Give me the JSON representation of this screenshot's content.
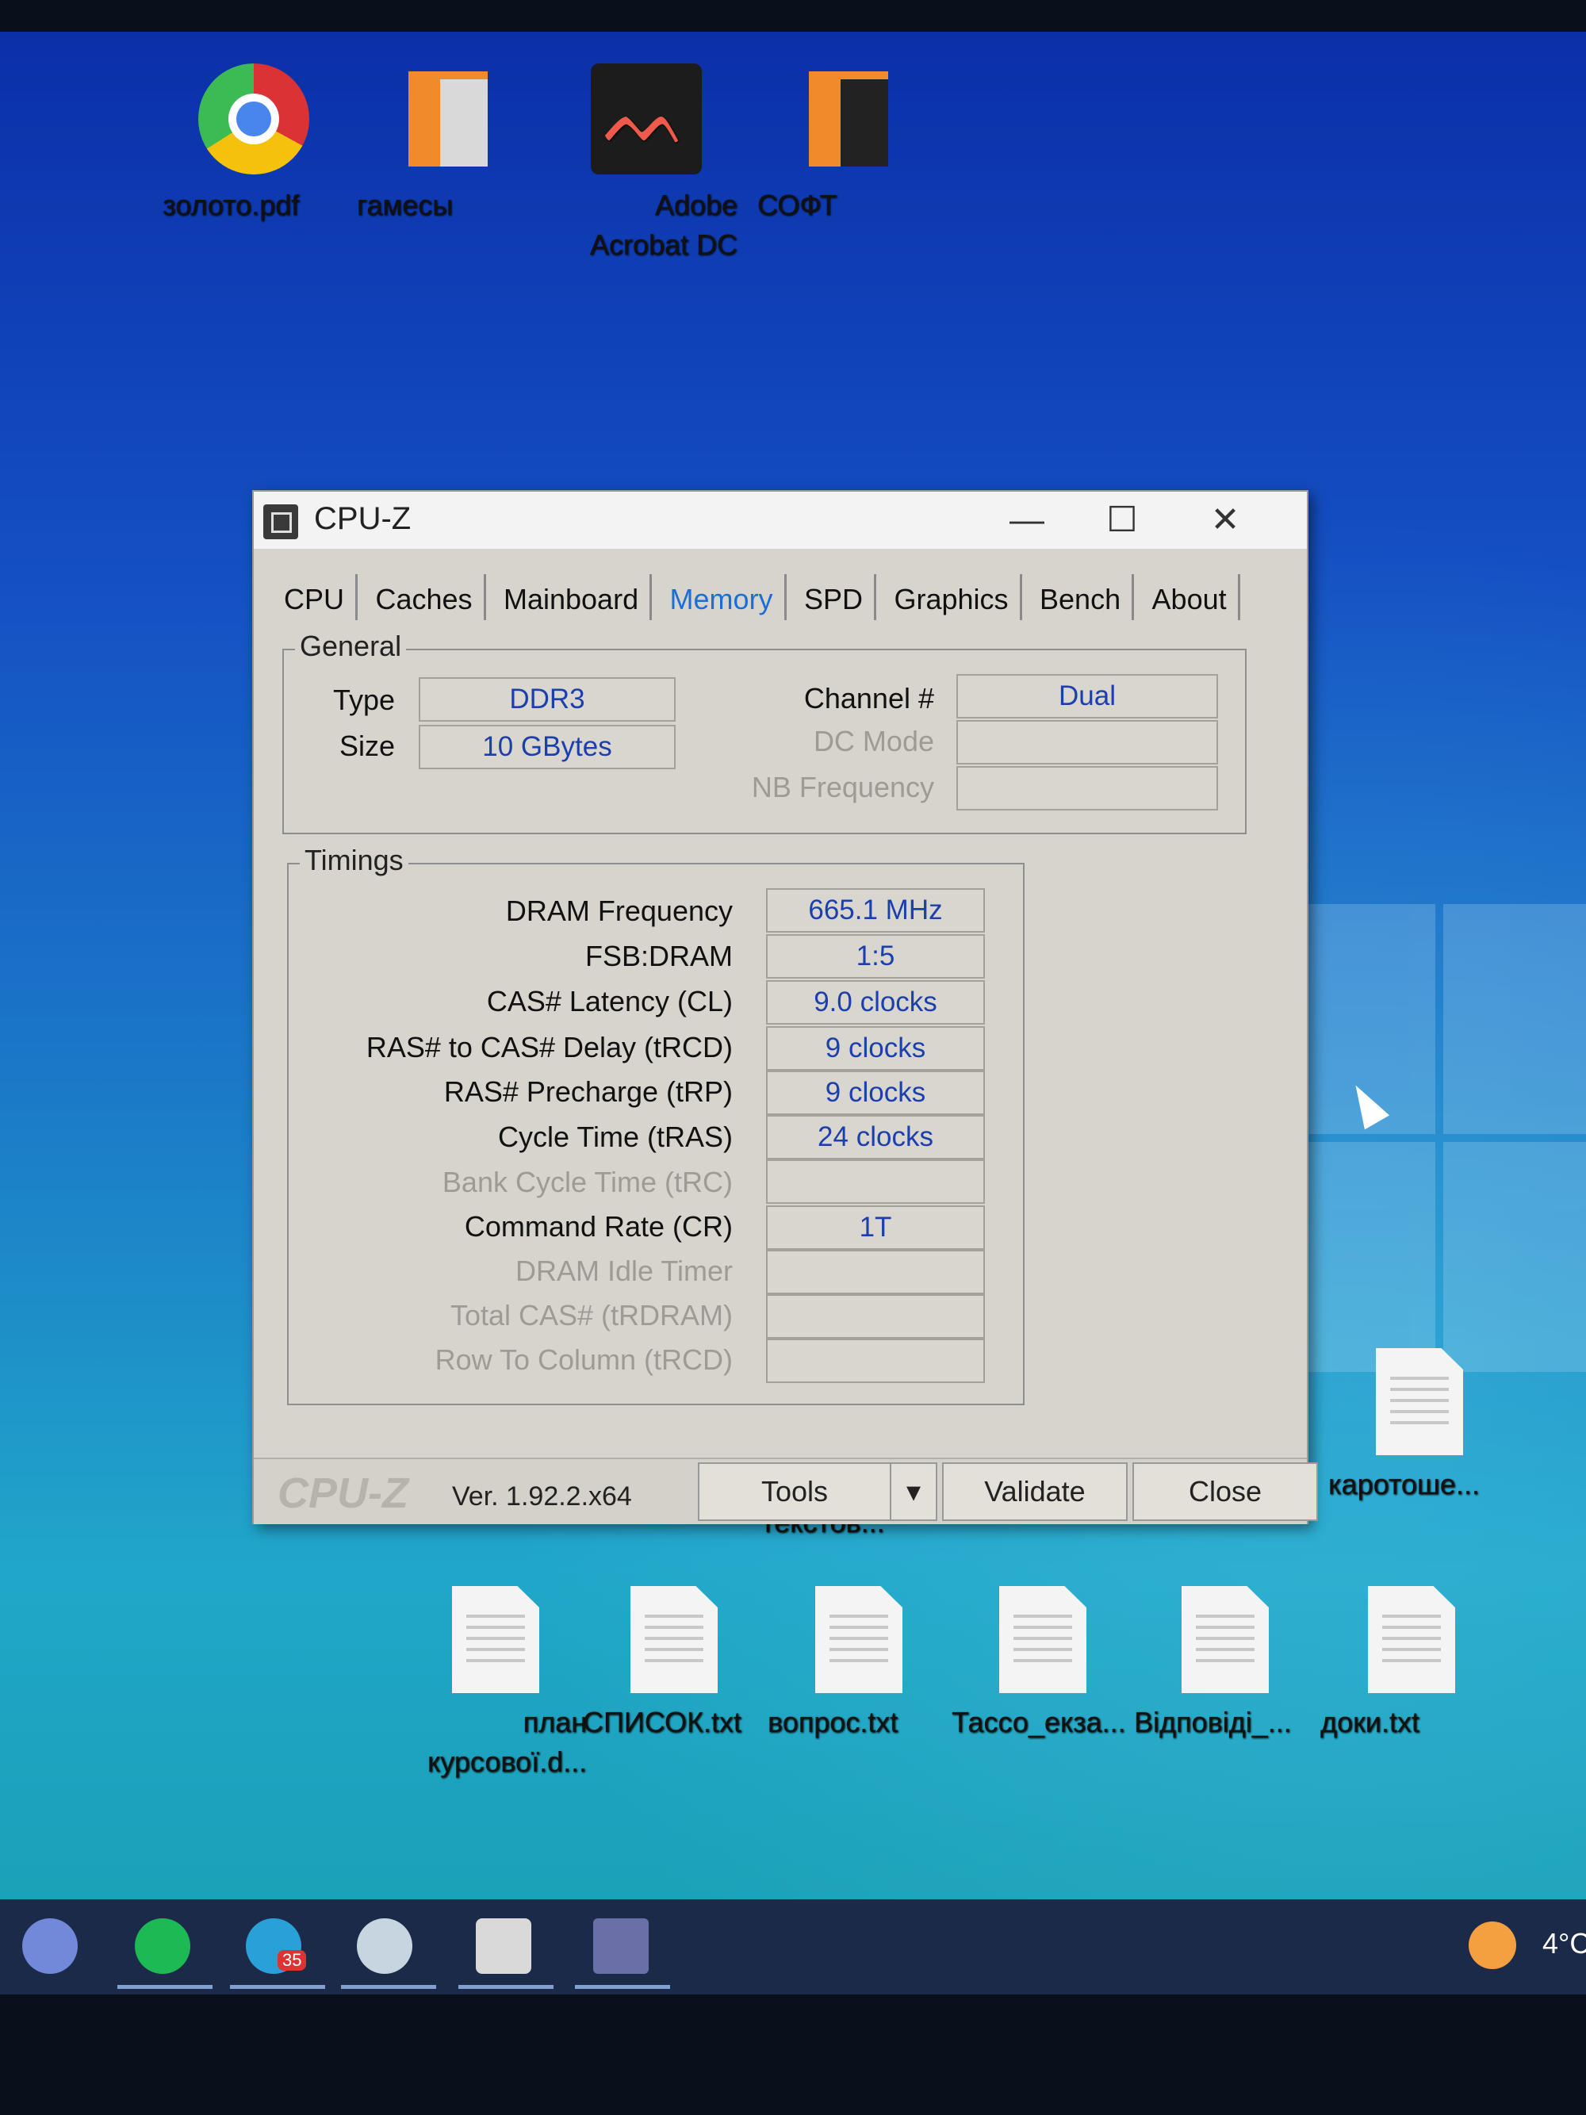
{
  "desktop": {
    "top_icons": [
      {
        "label": "золото.pdf",
        "icon": "chrome-pdf-icon"
      },
      {
        "label": "гамесы",
        "icon": "folder-icon"
      },
      {
        "label": "Adobe Acrobat DC",
        "icon": "acrobat-icon"
      },
      {
        "label": "СОФТ",
        "icon": "folder-icon"
      }
    ],
    "right_icon": {
      "label": "каротоше...",
      "icon": "text-file-icon"
    },
    "partial_label": "текстов...",
    "bottom_icons": [
      {
        "label": "план курсової.d...",
        "icon": "word-doc-icon"
      },
      {
        "label": "СПИСОК.txt",
        "icon": "text-file-icon"
      },
      {
        "label": "вопрос.txt",
        "icon": "text-file-icon"
      },
      {
        "label": "Тассо_екза...",
        "icon": "word-doc-icon"
      },
      {
        "label": "Відповіді_...",
        "icon": "word-doc-icon"
      },
      {
        "label": "доки.txt",
        "icon": "text-file-icon"
      }
    ]
  },
  "window": {
    "title": "CPU-Z",
    "controls": {
      "minimize": "—",
      "maximize": "☐",
      "close": "✕"
    },
    "tabs": [
      "CPU",
      "Caches",
      "Mainboard",
      "Memory",
      "SPD",
      "Graphics",
      "Bench",
      "About"
    ],
    "active_tab": "Memory",
    "general": {
      "title": "General",
      "type_label": "Type",
      "type_value": "DDR3",
      "size_label": "Size",
      "size_value": "10 GBytes",
      "channel_label": "Channel #",
      "channel_value": "Dual",
      "dc_mode_label": "DC Mode",
      "dc_mode_value": "",
      "nb_freq_label": "NB Frequency",
      "nb_freq_value": ""
    },
    "timings": {
      "title": "Timings",
      "rows": [
        {
          "label": "DRAM Frequency",
          "value": "665.1 MHz",
          "enabled": true
        },
        {
          "label": "FSB:DRAM",
          "value": "1:5",
          "enabled": true
        },
        {
          "label": "CAS# Latency (CL)",
          "value": "9.0 clocks",
          "enabled": true
        },
        {
          "label": "RAS# to CAS# Delay (tRCD)",
          "value": "9 clocks",
          "enabled": true
        },
        {
          "label": "RAS# Precharge (tRP)",
          "value": "9 clocks",
          "enabled": true
        },
        {
          "label": "Cycle Time (tRAS)",
          "value": "24 clocks",
          "enabled": true
        },
        {
          "label": "Bank Cycle Time (tRC)",
          "value": "",
          "enabled": false
        },
        {
          "label": "Command Rate (CR)",
          "value": "1T",
          "enabled": true
        },
        {
          "label": "DRAM Idle Timer",
          "value": "",
          "enabled": false
        },
        {
          "label": "Total CAS# (tRDRAM)",
          "value": "",
          "enabled": false
        },
        {
          "label": "Row To Column (tRCD)",
          "value": "",
          "enabled": false
        }
      ]
    },
    "footer": {
      "brand": "CPU-Z",
      "version": "Ver. 1.92.2.x64",
      "tools_label": "Tools",
      "validate_label": "Validate",
      "close_label": "Close"
    }
  },
  "taskbar": {
    "apps": [
      "discord-icon",
      "spotify-icon",
      "telegram-icon",
      "steam-icon",
      "folder-icon",
      "cpuz-icon"
    ],
    "telegram_badge": "35",
    "temperature": "4°C"
  }
}
